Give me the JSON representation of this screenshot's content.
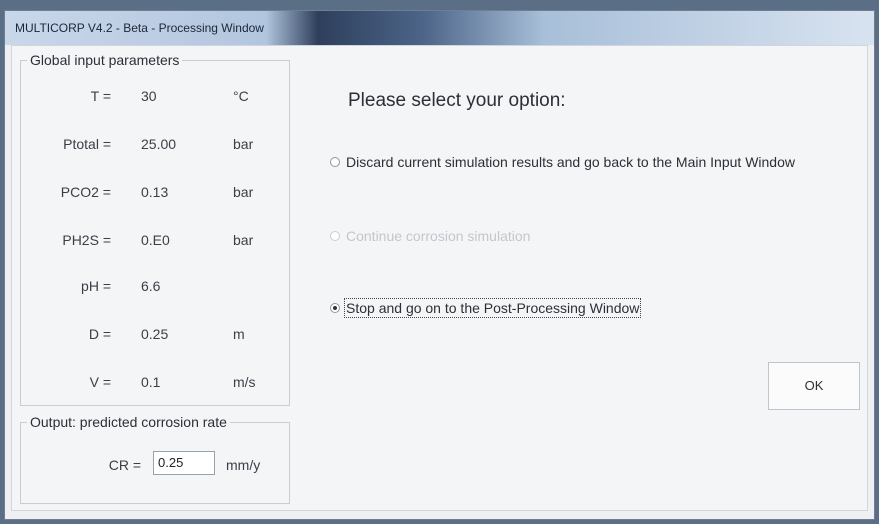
{
  "window": {
    "title": "MULTICORP V4.2 - Beta - Processing Window"
  },
  "global_params": {
    "title": "Global input parameters",
    "rows": [
      {
        "label": "T =",
        "value": "30",
        "unit": "°C"
      },
      {
        "label": "Ptotal =",
        "value": "25.00",
        "unit": "bar"
      },
      {
        "label": "PCO2 =",
        "value": "0.13",
        "unit": "bar"
      },
      {
        "label": "PH2S =",
        "value": "0.E0",
        "unit": "bar"
      },
      {
        "label": "pH =",
        "value": "6.6",
        "unit": ""
      },
      {
        "label": "D =",
        "value": "0.25",
        "unit": "m"
      },
      {
        "label": "V =",
        "value": "0.1",
        "unit": "m/s"
      }
    ]
  },
  "output": {
    "title": "Output: predicted corrosion rate",
    "cr_label": "CR =",
    "cr_value": "0.25",
    "cr_unit": "mm/y"
  },
  "options": {
    "prompt": "Please select your option:",
    "items": [
      {
        "label": "Discard current simulation results and go back to the Main Input Window",
        "checked": false,
        "enabled": true
      },
      {
        "label": "Continue corrosion simulation",
        "checked": false,
        "enabled": false
      },
      {
        "label": "Stop and go on to the Post-Processing Window",
        "checked": true,
        "enabled": true
      }
    ]
  },
  "buttons": {
    "ok_label": "OK"
  }
}
